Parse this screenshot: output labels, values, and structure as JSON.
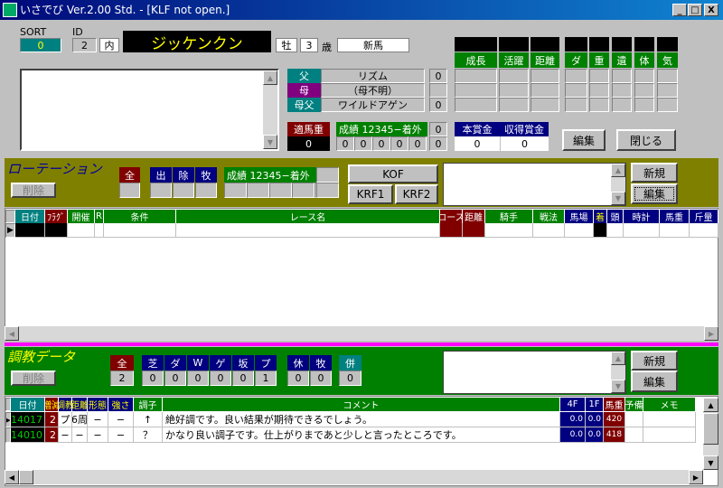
{
  "window": {
    "title": "いさでび Ver.2.00 Std.  - [KLF not open.]",
    "minimize": "_",
    "maximize": "□",
    "close": "X"
  },
  "horse": {
    "sort_label": "SORT",
    "sort_value": "0",
    "id_label": "ID",
    "id_value": "2",
    "location": "内",
    "name": "ジッケンクン",
    "sex": "牡",
    "age": "3",
    "age_unit": "歳",
    "class": "新馬"
  },
  "pedigree": [
    {
      "label": "父",
      "name": "リズム",
      "value": "0",
      "color": "#008080"
    },
    {
      "label": "母",
      "name": "（母不明）",
      "value": "",
      "color": "#800080"
    },
    {
      "label": "母父",
      "name": "ワイルドアゲン",
      "value": "0",
      "color": "#008080"
    }
  ],
  "weight": {
    "label": "適馬重",
    "value": "0"
  },
  "record": {
    "label": "成績 12345−着外",
    "values": [
      "0",
      "0",
      "0",
      "0",
      "0"
    ],
    "extra": [
      "0",
      "0"
    ]
  },
  "prize": {
    "main_label": "本賞金",
    "main_value": "0",
    "earned_label": "収得賞金",
    "earned_value": "0"
  },
  "top_buttons": {
    "edit": "編集",
    "close": "閉じる"
  },
  "stats_headers": [
    "成長",
    "活躍",
    "距離",
    "ダ",
    "重",
    "遺",
    "体",
    "気"
  ],
  "rotation": {
    "title": "ローテーション",
    "delete": "削除",
    "all": "全",
    "filters": [
      "出",
      "除",
      "牧"
    ],
    "record_label": "成績 12345−着外",
    "kof": "KOF",
    "krf1": "KRF1",
    "krf2": "KRF2",
    "new": "新規",
    "edit": "編集",
    "columns": [
      [
        "日付",
        "#008080"
      ],
      [
        "ﾌﾗｸﾞ",
        "#800000"
      ],
      [
        "開催",
        "#008000"
      ],
      [
        "R",
        "#008000"
      ],
      [
        "条件",
        "#008000"
      ],
      [
        "レース名",
        "#008000"
      ],
      [
        "コース",
        "#800000"
      ],
      [
        "距離",
        "#800000"
      ],
      [
        "騎手",
        "#008000"
      ],
      [
        "戦法",
        "#008000"
      ],
      [
        "馬場",
        "#000080"
      ],
      [
        "着",
        "#000080"
      ],
      [
        "頭",
        "#000080"
      ],
      [
        "時計",
        "#000080"
      ],
      [
        "馬重",
        "#000080"
      ],
      [
        "斤量",
        "#000080"
      ]
    ]
  },
  "training": {
    "title": "調教データ",
    "delete": "削除",
    "all_label": "全",
    "all_value": "2",
    "courses": [
      [
        "芝",
        "0"
      ],
      [
        "ダ",
        "0"
      ],
      [
        "W",
        "0"
      ],
      [
        "ゲ",
        "0"
      ],
      [
        "坂",
        "0"
      ],
      [
        "プ",
        "1"
      ]
    ],
    "rest": [
      [
        "休",
        "0"
      ],
      [
        "牧",
        "0"
      ]
    ],
    "combo": [
      [
        "併",
        "0"
      ]
    ],
    "new": "新規",
    "edit": "編集",
    "columns": [
      [
        "日付",
        "#008080"
      ],
      [
        "増減",
        "#800000"
      ],
      [
        "調教",
        "#000080"
      ],
      [
        "距離",
        "#000080"
      ],
      [
        "形態",
        "#000080"
      ],
      [
        "強さ",
        "#000080"
      ],
      [
        "調子",
        "#008000"
      ],
      [
        "コメント",
        "#008000"
      ],
      [
        "4F",
        "#000080"
      ],
      [
        "1F",
        "#000080"
      ],
      [
        "馬重",
        "#800000"
      ],
      [
        "予備",
        "#008000"
      ],
      [
        "メモ",
        "#008000"
      ]
    ],
    "rows": [
      [
        "14017",
        "2",
        "プ",
        "6周",
        "−",
        "−",
        "↑",
        "絶好調です。良い結果が期待できるでしょう。",
        "0.0",
        "0.0",
        "420",
        "",
        ""
      ],
      [
        "14010",
        "2",
        "−",
        "−",
        "−",
        "−",
        "？",
        "かなり良い調子です。仕上がりまであと少しと言ったところです。",
        "0.0",
        "0.0",
        "418",
        "",
        ""
      ]
    ]
  }
}
